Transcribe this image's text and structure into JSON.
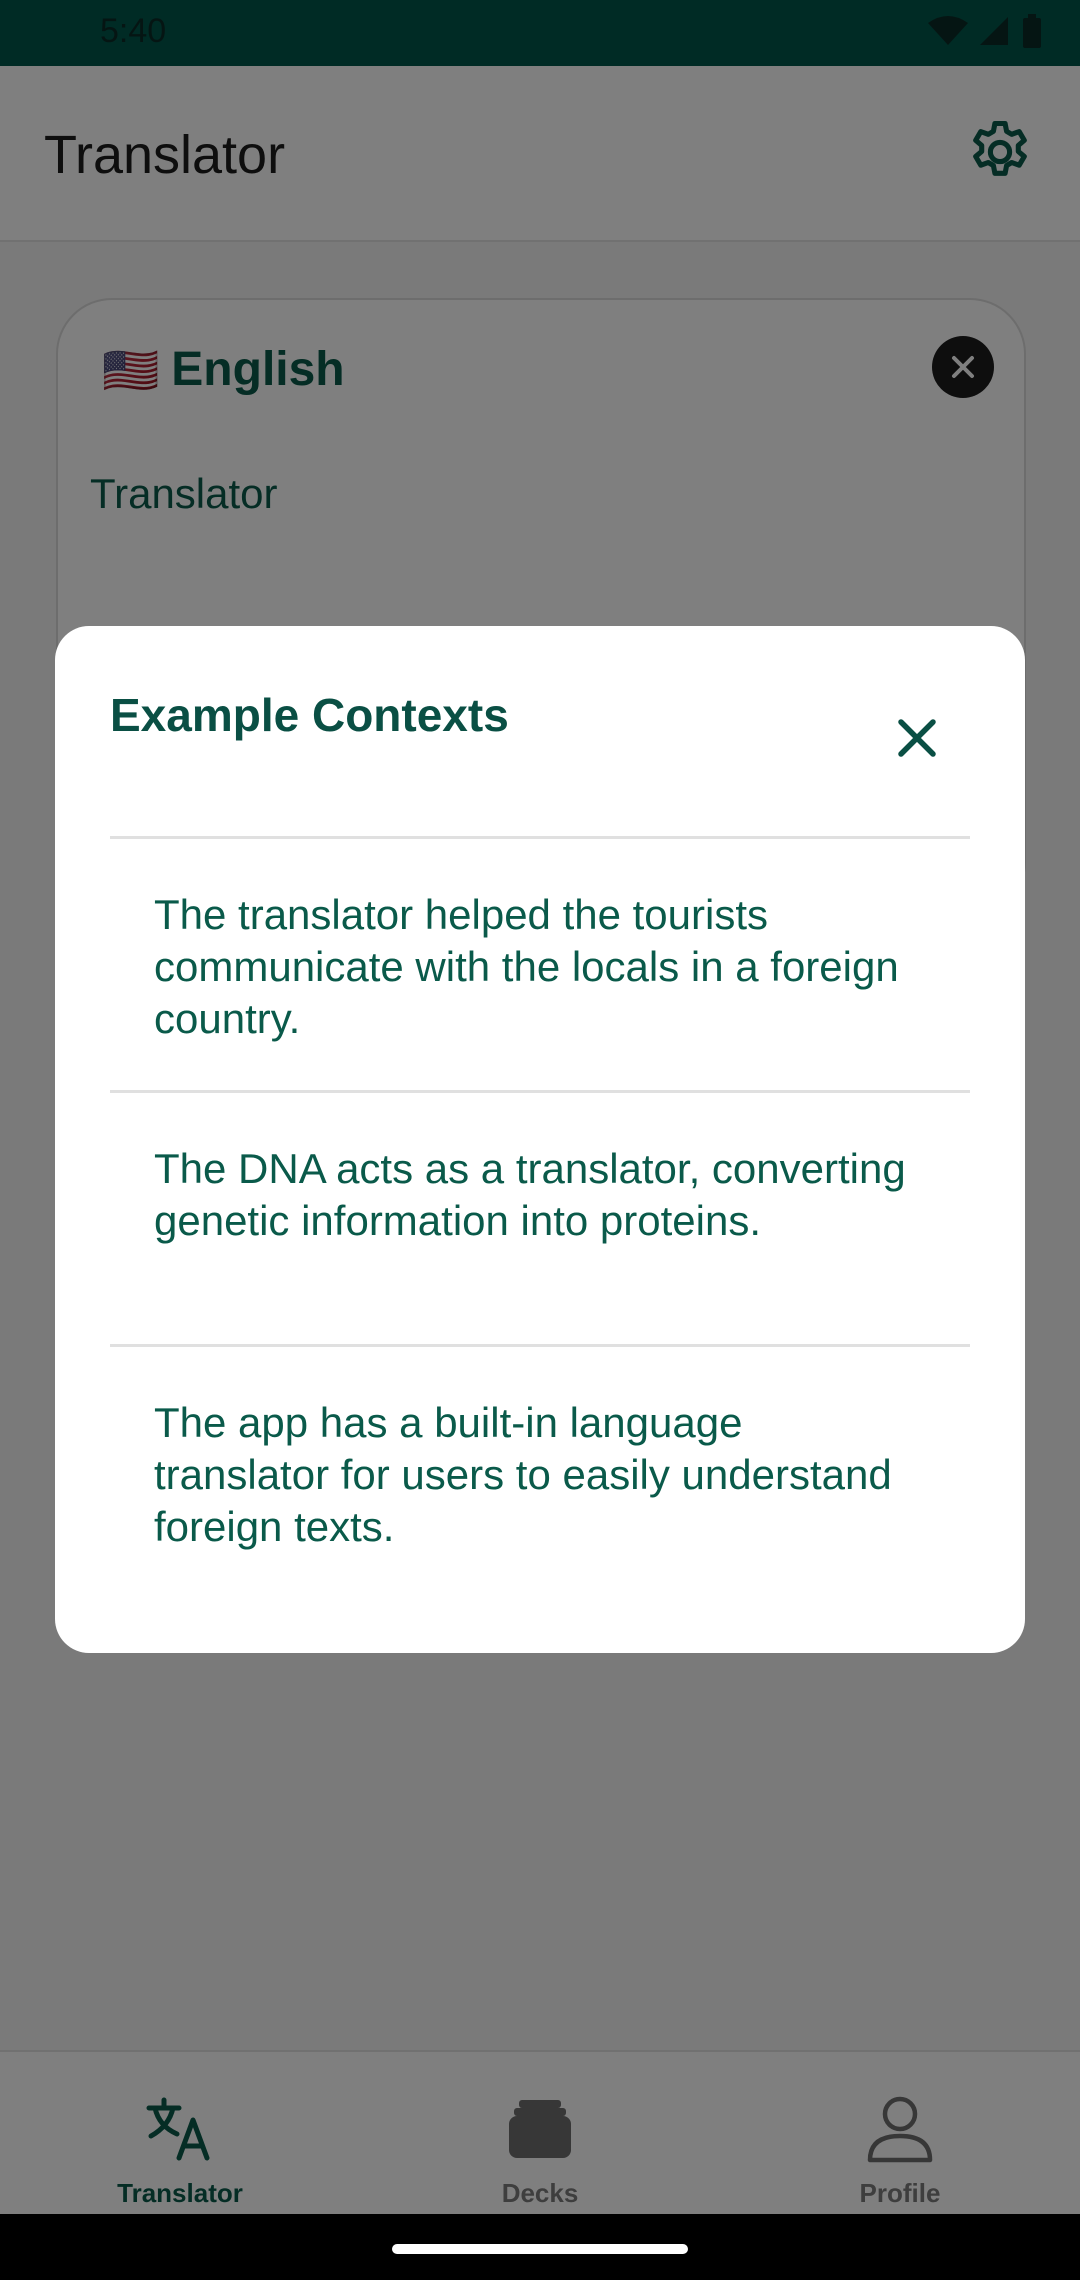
{
  "status_bar": {
    "time": "5:40"
  },
  "app_bar": {
    "title": "Translator"
  },
  "source_card": {
    "flag": "🇺🇸",
    "language": "English",
    "text": "Translator"
  },
  "dialog": {
    "title": "Example Contexts",
    "examples": [
      "The translator helped the tourists communicate with the locals in a foreign country.",
      "The DNA acts as a translator, converting genetic information into proteins.",
      "The app has a built-in language translator for users to easily understand foreign texts."
    ]
  },
  "bottom_nav": {
    "items": [
      {
        "label": "Translator",
        "icon": "translate-icon"
      },
      {
        "label": "Decks",
        "icon": "decks-icon"
      },
      {
        "label": "Profile",
        "icon": "profile-icon"
      }
    ]
  },
  "colors": {
    "primary": "#0a5a4a",
    "status_bar": "#00564a"
  }
}
